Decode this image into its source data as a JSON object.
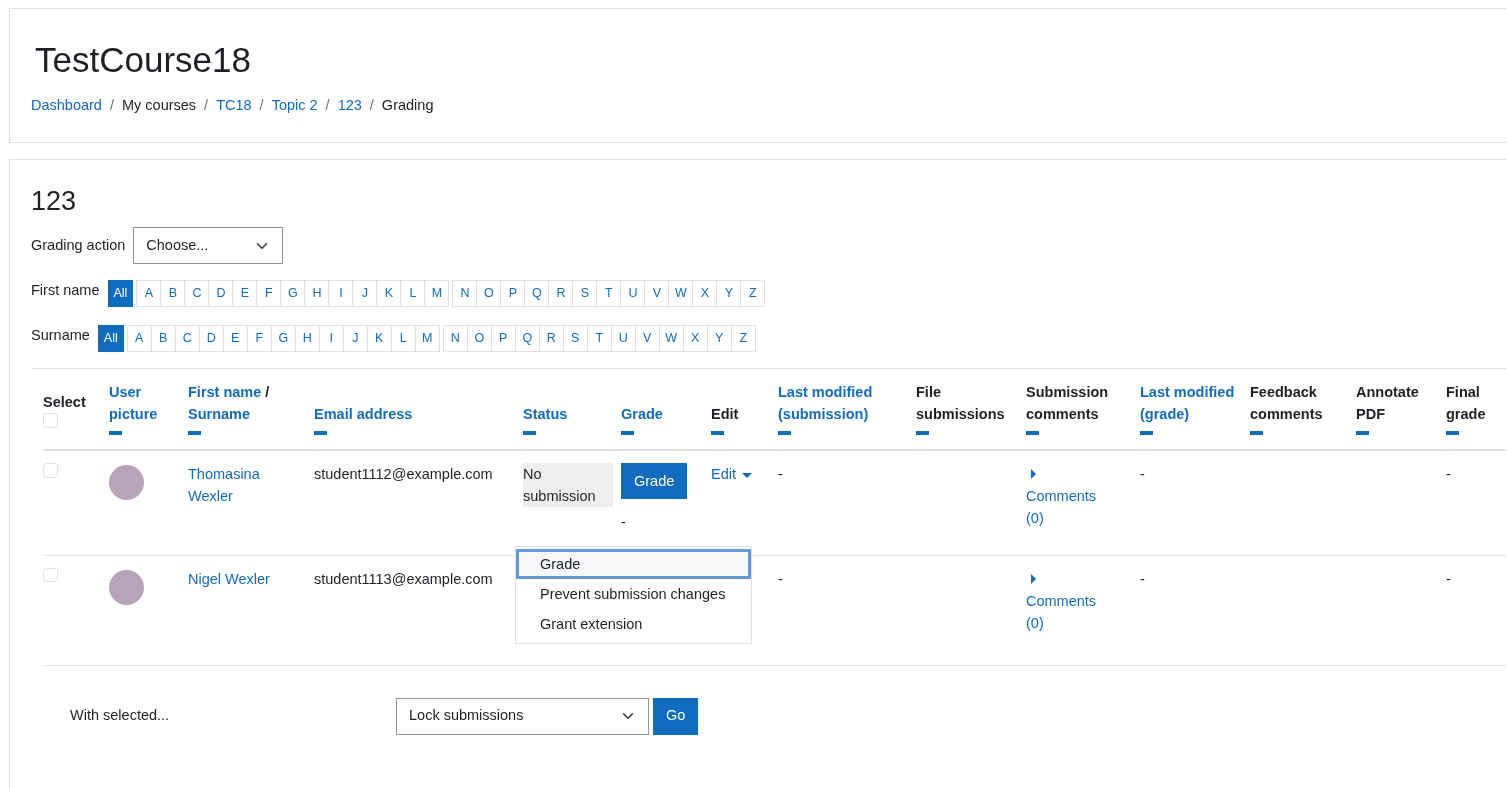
{
  "header": {
    "title": "TestCourse18",
    "breadcrumb": [
      {
        "kind": "link",
        "label": "Dashboard"
      },
      {
        "kind": "separator",
        "label": "/"
      },
      {
        "kind": "text",
        "label": "My courses"
      },
      {
        "kind": "separator",
        "label": "/"
      },
      {
        "kind": "link",
        "label": "TC18"
      },
      {
        "kind": "separator",
        "label": "/"
      },
      {
        "kind": "link",
        "label": "Topic 2"
      },
      {
        "kind": "separator",
        "label": "/"
      },
      {
        "kind": "link",
        "label": "123"
      },
      {
        "kind": "separator",
        "label": "/"
      },
      {
        "kind": "text",
        "label": "Grading"
      }
    ]
  },
  "assignment": {
    "title": "123",
    "grading_action": {
      "label": "Grading action",
      "value": "Choose..."
    },
    "filters": [
      {
        "label": "First name",
        "groups": [
          [
            {
              "label": "All",
              "selected": true
            }
          ],
          [
            {
              "label": "A",
              "selected": false
            },
            {
              "label": "B",
              "selected": false
            },
            {
              "label": "C",
              "selected": false
            },
            {
              "label": "D",
              "selected": false
            },
            {
              "label": "E",
              "selected": false
            },
            {
              "label": "F",
              "selected": false
            },
            {
              "label": "G",
              "selected": false
            },
            {
              "label": "H",
              "selected": false
            },
            {
              "label": "I",
              "selected": false
            },
            {
              "label": "J",
              "selected": false
            },
            {
              "label": "K",
              "selected": false
            },
            {
              "label": "L",
              "selected": false
            },
            {
              "label": "M",
              "selected": false
            }
          ],
          [
            {
              "label": "N",
              "selected": false
            },
            {
              "label": "O",
              "selected": false
            },
            {
              "label": "P",
              "selected": false
            },
            {
              "label": "Q",
              "selected": false
            },
            {
              "label": "R",
              "selected": false
            },
            {
              "label": "S",
              "selected": false
            },
            {
              "label": "T",
              "selected": false
            },
            {
              "label": "U",
              "selected": false
            },
            {
              "label": "V",
              "selected": false
            },
            {
              "label": "W",
              "selected": false
            },
            {
              "label": "X",
              "selected": false
            },
            {
              "label": "Y",
              "selected": false
            },
            {
              "label": "Z",
              "selected": false
            }
          ]
        ]
      },
      {
        "label": "Surname",
        "groups": [
          [
            {
              "label": "All",
              "selected": true
            }
          ],
          [
            {
              "label": "A",
              "selected": false
            },
            {
              "label": "B",
              "selected": false
            },
            {
              "label": "C",
              "selected": false
            },
            {
              "label": "D",
              "selected": false
            },
            {
              "label": "E",
              "selected": false
            },
            {
              "label": "F",
              "selected": false
            },
            {
              "label": "G",
              "selected": false
            },
            {
              "label": "H",
              "selected": false
            },
            {
              "label": "I",
              "selected": false
            },
            {
              "label": "J",
              "selected": false
            },
            {
              "label": "K",
              "selected": false
            },
            {
              "label": "L",
              "selected": false
            },
            {
              "label": "M",
              "selected": false
            }
          ],
          [
            {
              "label": "N",
              "selected": false
            },
            {
              "label": "O",
              "selected": false
            },
            {
              "label": "P",
              "selected": false
            },
            {
              "label": "Q",
              "selected": false
            },
            {
              "label": "R",
              "selected": false
            },
            {
              "label": "S",
              "selected": false
            },
            {
              "label": "T",
              "selected": false
            },
            {
              "label": "U",
              "selected": false
            },
            {
              "label": "V",
              "selected": false
            },
            {
              "label": "W",
              "selected": false
            },
            {
              "label": "X",
              "selected": false
            },
            {
              "label": "Y",
              "selected": false
            },
            {
              "label": "Z",
              "selected": false
            }
          ]
        ]
      }
    ],
    "table": {
      "columns": [
        {
          "kind": "select",
          "label": "Select",
          "checked": false
        },
        {
          "kind": "sort",
          "label": "User picture"
        },
        {
          "kind": "name",
          "first": "First name",
          "separator": "/",
          "last": "Surname"
        },
        {
          "kind": "sort",
          "label": "Email address"
        },
        {
          "kind": "sort",
          "label": "Status"
        },
        {
          "kind": "sort",
          "label": "Grade"
        },
        {
          "kind": "plain",
          "label": "Edit"
        },
        {
          "kind": "sort",
          "label": "Last modified (submission)"
        },
        {
          "kind": "plain",
          "label": "File submissions"
        },
        {
          "kind": "plain",
          "label": "Submission comments"
        },
        {
          "kind": "sort",
          "label": "Last modified (grade)"
        },
        {
          "kind": "plain",
          "label": "Feedback comments"
        },
        {
          "kind": "plain",
          "label": "Annotate PDF"
        },
        {
          "kind": "plain",
          "label": "Final grade"
        }
      ],
      "rows": [
        {
          "checked": false,
          "name": "Thomasina Wexler",
          "email": "student1112@example.com",
          "status": "No submission",
          "grade_button": "Grade",
          "grade": "-",
          "edit": "Edit",
          "edit_menu": [
            {
              "label": "Grade",
              "selected": true
            },
            {
              "label": "Prevent submission changes",
              "selected": false
            },
            {
              "label": "Grant extension",
              "selected": false
            }
          ],
          "last_modified": "-",
          "comments": "Comments (0)",
          "last_modified_grade": "-",
          "final_grade": "-"
        },
        {
          "checked": false,
          "name": "Nigel Wexler",
          "email": "student1113@example.com",
          "last_modified": "-",
          "comments": "Comments (0)",
          "last_modified_grade": "-",
          "final_grade": "-"
        }
      ]
    },
    "bulk": {
      "label": "With selected...",
      "value": "Lock submissions",
      "button": "Go"
    }
  }
}
